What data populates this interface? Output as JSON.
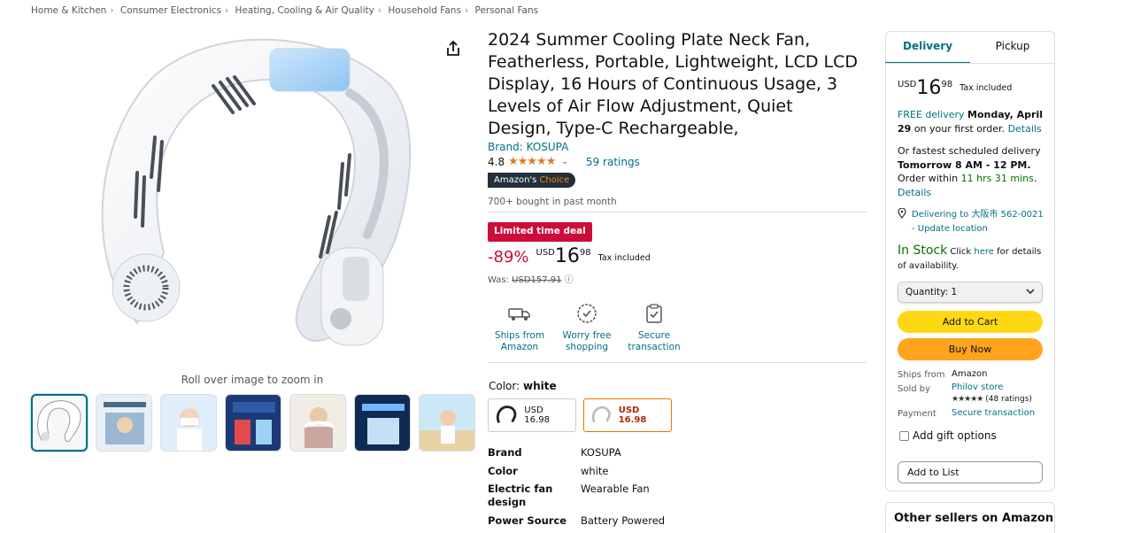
{
  "breadcrumb": [
    "Home & Kitchen",
    "Consumer Electronics",
    "Heating, Cooling & Air Quality",
    "Household Fans",
    "Personal Fans"
  ],
  "gallery": {
    "zoom_hint": "Roll over image to zoom in",
    "thumbnail_count": 7
  },
  "product": {
    "title": "2024 Summer Cooling Plate Neck Fan, Featherless, Portable, Lightweight, LCD LCD Display, 16 Hours of Continuous Usage, 3 Levels of Air Flow Adjustment, Quiet Design, Type-C Rechargeable,",
    "brand": "Brand: KOSUPA",
    "rating": "4.8",
    "stars": "★★★★★",
    "ratings_count": "59 ratings",
    "badge_prefix": "Amazon's",
    "badge_choice": "Choice",
    "bought": "700+ bought in past month",
    "deal": "Limited time deal",
    "discount": "-89%",
    "currency": "USD",
    "price_whole": "16",
    "price_fraction": "98",
    "tax": "Tax included",
    "was_label": "Was:",
    "was_price": "USD157.91",
    "info_icon": "ⓘ"
  },
  "features": [
    {
      "label": "Ships from Amazon",
      "icon": "truck-icon"
    },
    {
      "label": "Worry free shopping",
      "icon": "shield-badge-icon"
    },
    {
      "label": "Secure transaction",
      "icon": "secure-clipboard-icon"
    }
  ],
  "color": {
    "label": "Color:",
    "selected": "white",
    "options": [
      {
        "price": "USD 16.98",
        "variant": "black"
      },
      {
        "price": "USD 16.98",
        "variant": "white"
      }
    ]
  },
  "specs": [
    {
      "key": "Brand",
      "value": "KOSUPA"
    },
    {
      "key": "Color",
      "value": "white"
    },
    {
      "key": "Electric fan design",
      "value": "Wearable Fan"
    },
    {
      "key": "Power Source",
      "value": "Battery Powered"
    }
  ],
  "buybox": {
    "tabs": [
      "Delivery",
      "Pickup"
    ],
    "currency": "USD",
    "price_whole": "16",
    "price_fraction": "98",
    "tax": "Tax included",
    "free_delivery": "FREE delivery",
    "delivery_date": "Monday, April 29",
    "delivery_tail": "on your first order.",
    "details": "Details",
    "fastest_line": "Or fastest scheduled delivery",
    "fastest_time": "Tomorrow 8 AM - 12 PM",
    "order_within": "Order within",
    "countdown": "11 hrs 31 mins",
    "location": "Delivering to 大阪市 562-0021 - Update location",
    "in_stock": "In Stock",
    "click_here_pre": "Click",
    "here": "here",
    "click_here_post": "for details of availability.",
    "quantity": "Quantity: 1",
    "add_to_cart": "Add to Cart",
    "buy_now": "Buy Now",
    "ships_from_label": "Ships from",
    "ships_from_value": "Amazon",
    "sold_by_label": "Sold by",
    "sold_by_value": "Philov store",
    "seller_stars": "★★★★★",
    "seller_ratings": "(48 ratings)",
    "payment_label": "Payment",
    "payment_value": "Secure transaction",
    "gift": "Add gift options",
    "add_to_list": "Add to List",
    "other_sellers": "Other sellers on Amazon"
  },
  "colors": {
    "link": "#007185",
    "deal_red": "#cc0c39",
    "cart_yellow": "#ffd814",
    "buy_orange": "#ffa41c",
    "stock_green": "#007600",
    "star_orange": "#de7921"
  }
}
